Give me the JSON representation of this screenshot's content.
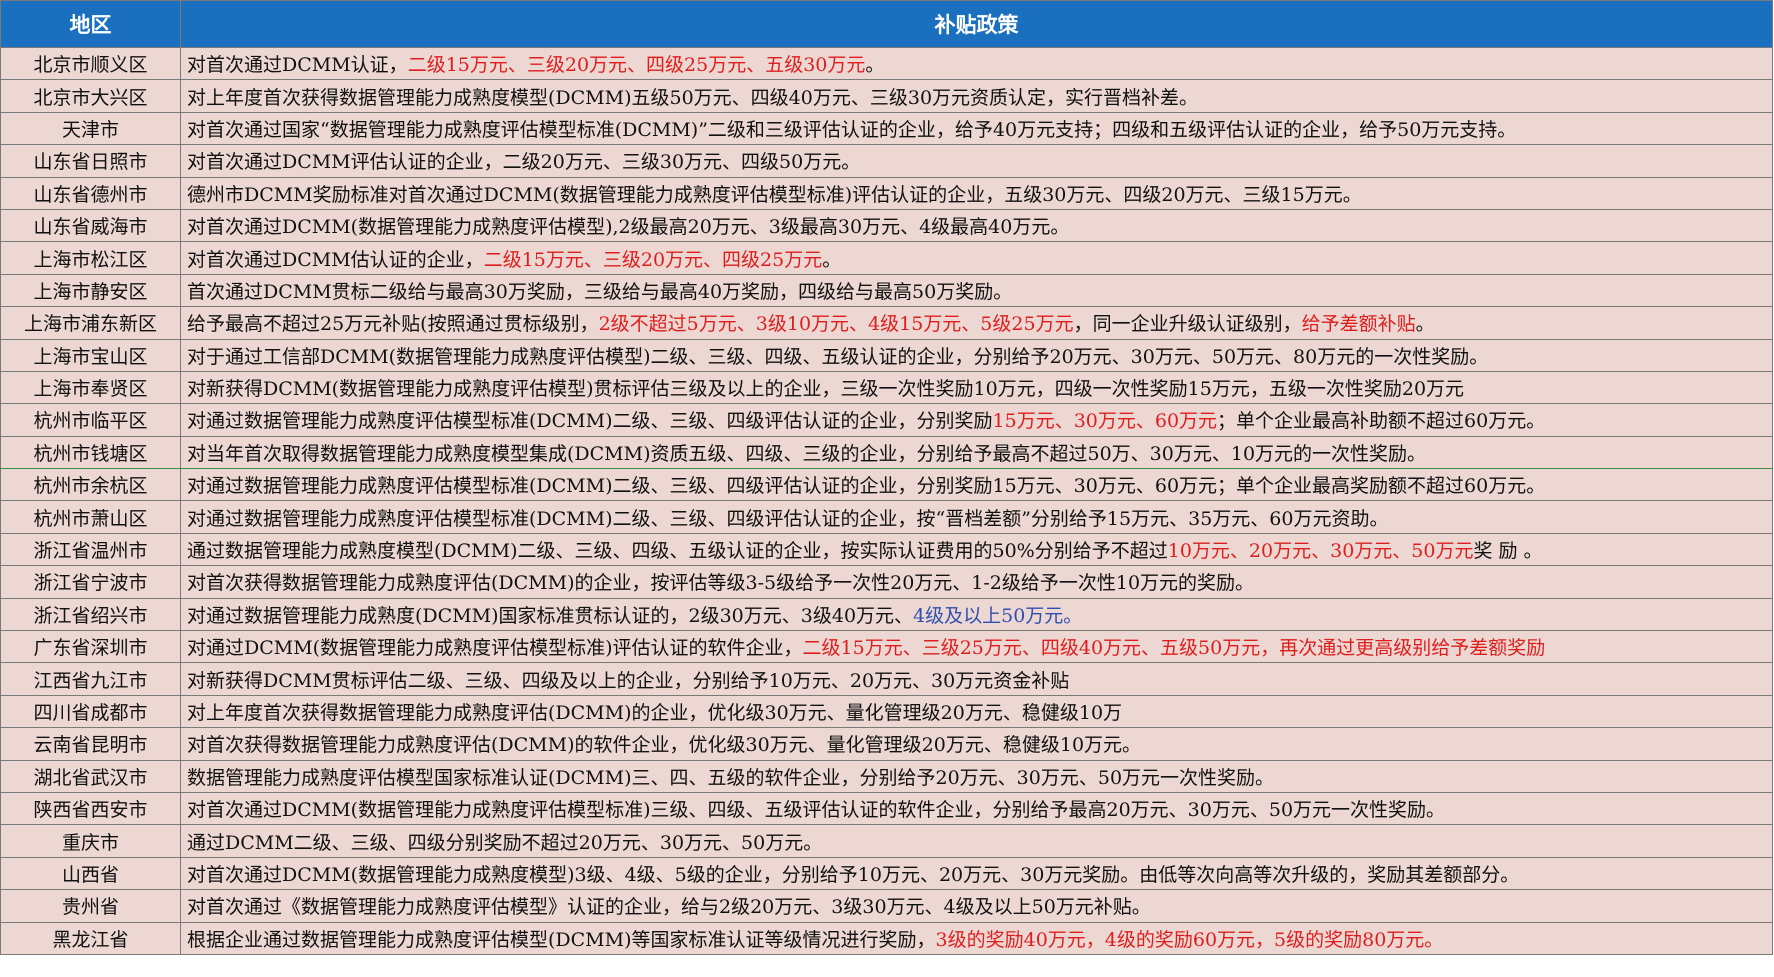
{
  "header": {
    "region": "地区",
    "policy": "补贴政策"
  },
  "colors": {
    "header_bg": "#1a6fbf",
    "cell_bg": "#ecd7d2",
    "highlight_red": "#e01d1d",
    "highlight_blue": "#2f4fb0"
  },
  "rows": [
    {
      "region": "北京市顺义区",
      "policy": [
        {
          "text": "对首次通过DCMM认证，"
        },
        {
          "text": "二级15万元、三级20万元、四级25万元、五级30万元",
          "color": "red"
        },
        {
          "text": "。"
        }
      ]
    },
    {
      "region": "北京市大兴区",
      "policy": [
        {
          "text": "对上年度首次获得数据管理能力成熟度模型(DCMM)五级50万元、四级40万元、三级30万元资质认定，实行晋档补差。"
        }
      ]
    },
    {
      "region": "天津市",
      "policy": [
        {
          "text": "对首次通过国家“数据管理能力成熟度评估模型标准(DCMM)”二级和三级评估认证的企业，给予40万元支持；四级和五级评估认证的企业，给予50万元支持。"
        }
      ]
    },
    {
      "region": "山东省日照市",
      "policy": [
        {
          "text": "对首次通过DCMM评估认证的企业，二级20万元、三级30万元、四级50万元。"
        }
      ]
    },
    {
      "region": "山东省德州市",
      "policy": [
        {
          "text": "德州市DCMM奖励标准对首次通过DCMM(数据管理能力成熟度评估模型标准)评估认证的企业，五级30万元、四级20万元、三级15万元。"
        }
      ]
    },
    {
      "region": "山东省威海市",
      "policy": [
        {
          "text": "对首次通过DCMM(数据管理能力成熟度评估模型),2级最高20万元、3级最高30万元、4级最高40万元。"
        }
      ]
    },
    {
      "region": "上海市松江区",
      "policy": [
        {
          "text": "对首次通过DCMM估认证的企业，"
        },
        {
          "text": "二级15万元、三级20万元、四级25万元",
          "color": "red"
        },
        {
          "text": "。"
        }
      ]
    },
    {
      "region": "上海市静安区",
      "policy": [
        {
          "text": "首次通过DCMM贯标二级给与最高30万奖励，三级给与最高40万奖励，四级给与最高50万奖励。"
        }
      ]
    },
    {
      "region": "上海市浦东新区",
      "policy": [
        {
          "text": "给予最高不超过25万元补贴(按照通过贯标级别，"
        },
        {
          "text": "2级不超过5万元、3级10万元、4级15万元、5级25万元",
          "color": "red"
        },
        {
          "text": "，同一企业升级认证级别，"
        },
        {
          "text": "给予差额补贴",
          "color": "red"
        },
        {
          "text": "。"
        }
      ]
    },
    {
      "region": "上海市宝山区",
      "policy": [
        {
          "text": "对于通过工信部DCMM(数据管理能力成熟度评估模型)二级、三级、四级、五级认证的企业，分别给予20万元、30万元、50万元、80万元的一次性奖励。"
        }
      ]
    },
    {
      "region": "上海市奉贤区",
      "policy": [
        {
          "text": "对新获得DCMM(数据管理能力成熟度评估模型)贯标评估三级及以上的企业，三级一次性奖励10万元，四级一次性奖励15万元，五级一次性奖励20万元"
        }
      ]
    },
    {
      "region": "杭州市临平区",
      "policy": [
        {
          "text": "对通过数据管理能力成熟度评估模型标准(DCMM)二级、三级、四级评估认证的企业，分别奖励"
        },
        {
          "text": "15万元、30万元、60万元",
          "color": "red"
        },
        {
          "text": "；单个企业最高补助额不超过60万元。"
        }
      ]
    },
    {
      "region": "杭州市钱塘区",
      "selected": true,
      "policy": [
        {
          "text": "对当年首次取得数据管理能力成熟度模型集成(DCMM)资质五级、四级、三级的企业，分别给予最高不超过50万、30万元、10万元的一次性奖励。"
        }
      ]
    },
    {
      "region": "杭州市余杭区",
      "policy": [
        {
          "text": "对通过数据管理能力成熟度评估模型标准(DCMM)二级、三级、四级评估认证的企业，分别奖励15万元、30万元、60万元；单个企业最高奖励额不超过60万元。"
        }
      ]
    },
    {
      "region": "杭州市萧山区",
      "policy": [
        {
          "text": "对通过数据管理能力成熟度评估模型标准(DCMM)二级、三级、四级评估认证的企业，按“晋档差额”分别给予15万元、35万元、60万元资助。"
        }
      ]
    },
    {
      "region": "浙江省温州市",
      "policy": [
        {
          "text": "通过数据管理能力成熟度模型(DCMM)二级、三级、四级、五级认证的企业，按实际认证费用的50%分别给予不超过"
        },
        {
          "text": "10万元、20万元、30万元、50万元",
          "color": "red"
        },
        {
          "text": "奖 励 。"
        }
      ]
    },
    {
      "region": "浙江省宁波市",
      "policy": [
        {
          "text": "对首次获得数据管理能力成熟度评估(DCMM)的企业，按评估等级3-5级给予一次性20万元、1-2级给予一次性10万元的奖励。"
        }
      ]
    },
    {
      "region": "浙江省绍兴市",
      "policy": [
        {
          "text": "对通过数据管理能力成熟度(DCMM)国家标准贯标认证的，2级30万元、3级40万元、"
        },
        {
          "text": "4级及以上50万元。",
          "color": "blue"
        }
      ]
    },
    {
      "region": "广东省深圳市",
      "policy": [
        {
          "text": "对通过DCMM(数据管理能力成熟度评估模型标准)评估认证的软件企业，"
        },
        {
          "text": "二级15万元、三级25万元、四级40万元、五级50万元，再次通过更高级别给予差额奖励",
          "color": "red"
        }
      ]
    },
    {
      "region": "江西省九江市",
      "policy": [
        {
          "text": "对新获得DCMM贯标评估二级、三级、四级及以上的企业，分别给予10万元、20万元、30万元资金补贴"
        }
      ]
    },
    {
      "region": "四川省成都市",
      "policy": [
        {
          "text": "对上年度首次获得数据管理能力成熟度评估(DCMM)的企业，优化级30万元、量化管理级20万元、稳健级10万"
        }
      ]
    },
    {
      "region": "云南省昆明市",
      "policy": [
        {
          "text": "对首次获得数据管理能力成熟度评估(DCMM)的软件企业，优化级30万元、量化管理级20万元、稳健级10万元。"
        }
      ]
    },
    {
      "region": "湖北省武汉市",
      "policy": [
        {
          "text": "数据管理能力成熟度评估模型国家标准认证(DCMM)三、四、五级的软件企业，分别给予20万元、30万元、50万元一次性奖励。"
        }
      ]
    },
    {
      "region": "陕西省西安市",
      "policy": [
        {
          "text": "对首次通过DCMM(数据管理能力成熟度评估模型标准)三级、四级、五级评估认证的软件企业，分别给予最高20万元、30万元、50万元一次性奖励。"
        }
      ]
    },
    {
      "region": "重庆市",
      "policy": [
        {
          "text": "通过DCMM二级、三级、四级分别奖励不超过20万元、30万元、50万元。"
        }
      ]
    },
    {
      "region": "山西省",
      "policy": [
        {
          "text": "对首次通过DCMM(数据管理能力成熟度模型)3级、4级、5级的企业，分别给予10万元、20万元、30万元奖励。由低等次向高等次升级的，奖励其差额部分。"
        }
      ]
    },
    {
      "region": "贵州省",
      "policy": [
        {
          "text": "对首次通过《数据管理能力成熟度评估模型》认证的企业，给与2级20万元、3级30万元、4级及以上50万元补贴。"
        }
      ]
    },
    {
      "region": "黑龙江省",
      "policy": [
        {
          "text": "根据企业通过数据管理能力成熟度评估模型(DCMM)等国家标准认证等级情况进行奖励，"
        },
        {
          "text": "3级的奖励40万元，4级的奖励60万元，5级的奖励80万元。",
          "color": "red"
        }
      ]
    }
  ]
}
